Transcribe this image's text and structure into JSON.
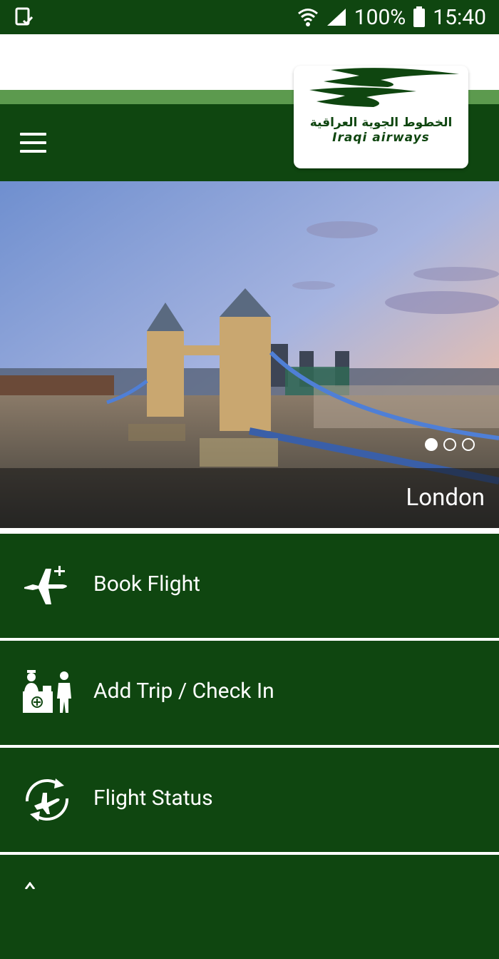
{
  "status_bar": {
    "battery": "100%",
    "time": "15:40",
    "icons": [
      "screenshot-icon",
      "wifi-icon",
      "signal-icon",
      "battery-icon"
    ]
  },
  "header": {
    "logo_arabic": "الخطوط الجوية العراقية",
    "logo_latin": "Iraqi airways",
    "menu_icon": "hamburger-menu-icon"
  },
  "hero": {
    "caption": "London",
    "slides_count": 3,
    "active_slide": 1
  },
  "menu": {
    "items": [
      {
        "label": "Book Flight",
        "icon": "plane-plus-icon"
      },
      {
        "label": "Add Trip / Check In",
        "icon": "check-in-desk-icon"
      },
      {
        "label": "Flight Status",
        "icon": "flight-status-icon"
      }
    ]
  },
  "colors": {
    "primary": "#0f4610",
    "stripe": "#5c9a4e",
    "text_on_primary": "#ffffff"
  }
}
